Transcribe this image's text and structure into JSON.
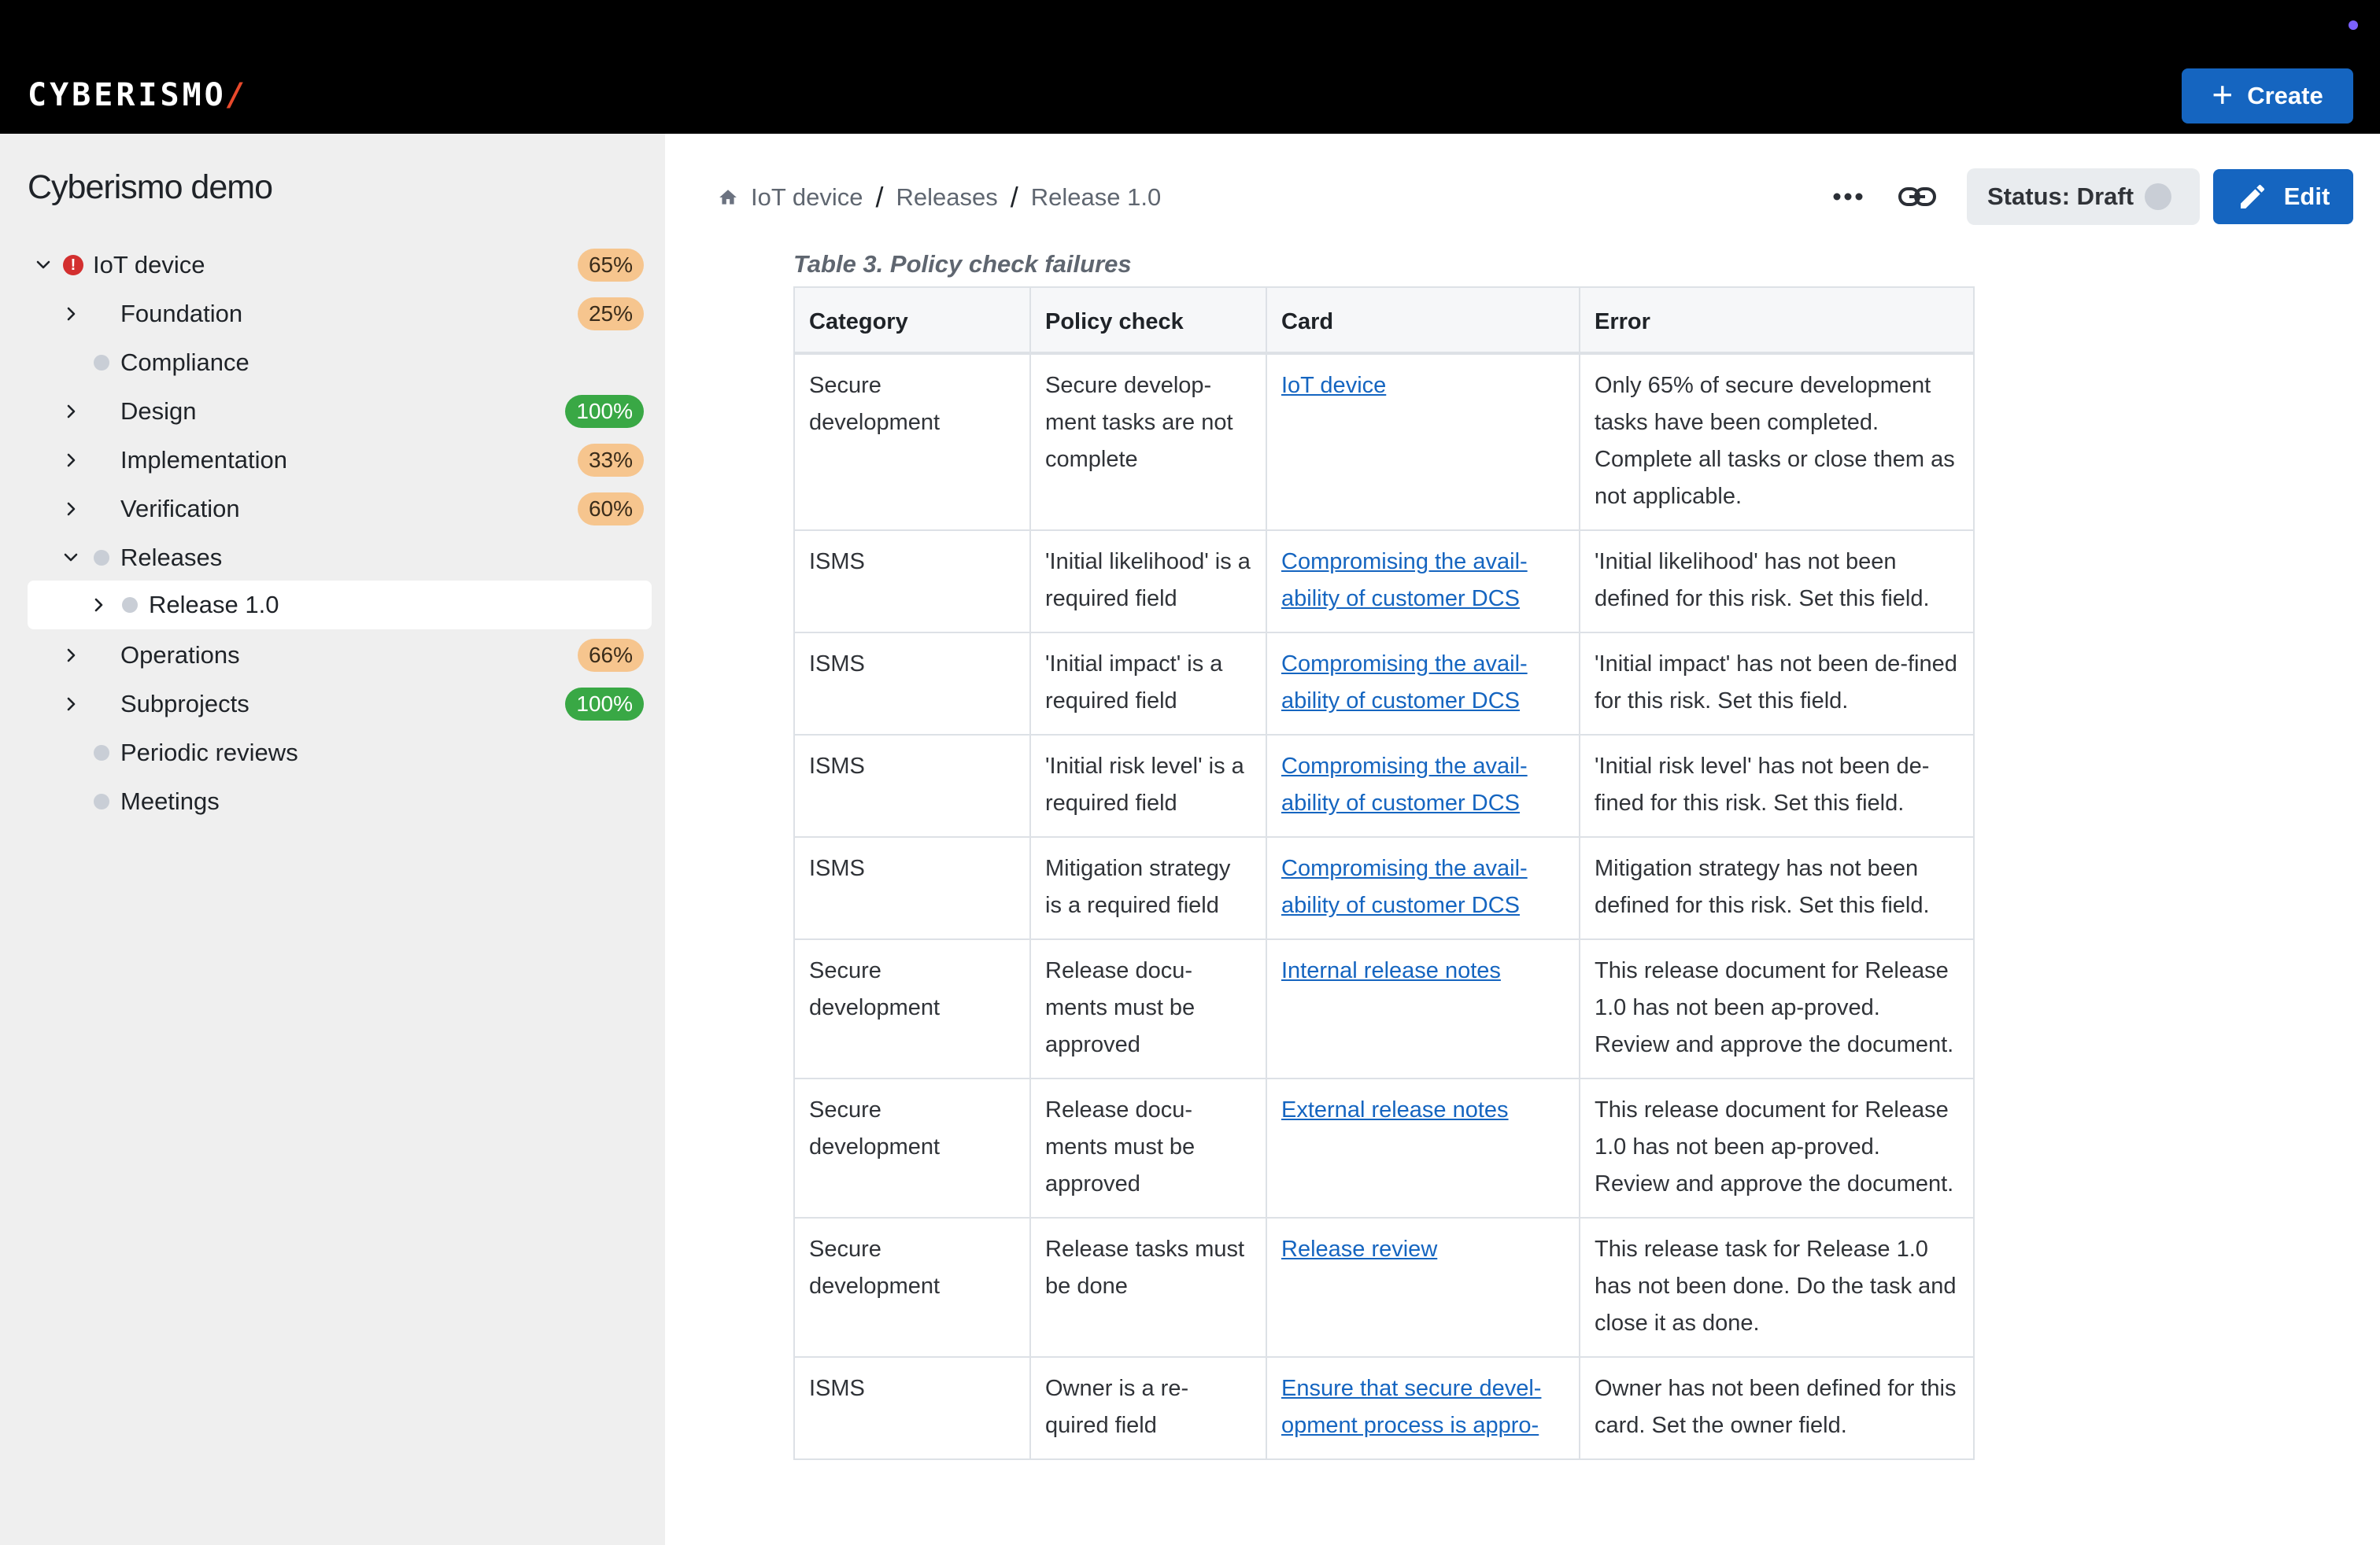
{
  "app": {
    "logo": "CYBERISMO",
    "logo_mark": "/",
    "create_label": "Create"
  },
  "sidebar": {
    "project_title": "Cyberismo demo",
    "items": [
      {
        "label": "IoT device",
        "badge": "65%"
      },
      {
        "label": "Foundation",
        "badge": "25%"
      },
      {
        "label": "Compliance"
      },
      {
        "label": "Design",
        "badge": "100%"
      },
      {
        "label": "Implementation",
        "badge": "33%"
      },
      {
        "label": "Verification",
        "badge": "60%"
      },
      {
        "label": "Releases"
      },
      {
        "label": "Release 1.0"
      },
      {
        "label": "Operations",
        "badge": "66%"
      },
      {
        "label": "Subprojects",
        "badge": "100%"
      },
      {
        "label": "Periodic reviews"
      },
      {
        "label": "Meetings"
      }
    ],
    "alert_glyph": "!"
  },
  "header": {
    "breadcrumb": [
      "IoT device",
      "Releases",
      "Release 1.0"
    ],
    "separator": "/",
    "status_label": "Status: Draft",
    "edit_label": "Edit"
  },
  "table": {
    "caption": "Table 3. Policy check failures",
    "headers": [
      "Category",
      "Policy check",
      "Card",
      "Error"
    ],
    "rows": [
      [
        "Secure development",
        "Secure develop-ment tasks are not complete",
        "IoT device",
        "Only 65% of secure development tasks have been completed. Complete all tasks or close them as not applicable."
      ],
      [
        "ISMS",
        "'Initial likelihood' is a required field",
        "Compromising the avail-ability of customer DCS",
        "'Initial likelihood' has not been defined for this risk. Set this field."
      ],
      [
        "ISMS",
        "'Initial impact' is a required field",
        "Compromising the avail-ability of customer DCS",
        "'Initial impact' has not been de-fined for this risk. Set this field."
      ],
      [
        "ISMS",
        "'Initial risk level' is a required field",
        "Compromising the avail-ability of customer DCS",
        "'Initial risk level' has not been de-fined for this risk. Set this field."
      ],
      [
        "ISMS",
        "Mitigation strategy is a required field",
        "Compromising the avail-ability of customer DCS",
        "Mitigation strategy has not been defined for this risk. Set this field."
      ],
      [
        "Secure development",
        "Release docu-ments must be approved",
        "Internal release notes",
        "This release document for Release 1.0 has not been ap-proved. Review and approve the document."
      ],
      [
        "Secure development",
        "Release docu-ments must be approved",
        "External release notes",
        "This release document for Release 1.0 has not been ap-proved. Review and approve the document."
      ],
      [
        "Secure development",
        "Release tasks must be done",
        "Release review",
        "This release task for Release 1.0 has not been done. Do the task and close it as done."
      ],
      [
        "ISMS",
        "Owner is a re-quired field",
        "Ensure that secure devel-opment process is appro-",
        "Owner has not been defined for this card. Set the owner field."
      ]
    ]
  },
  "colors": {
    "accent": "#1565c0",
    "badge_orange": "#f6c58e",
    "badge_green": "#39a845",
    "alert_red": "#d32f2f"
  }
}
